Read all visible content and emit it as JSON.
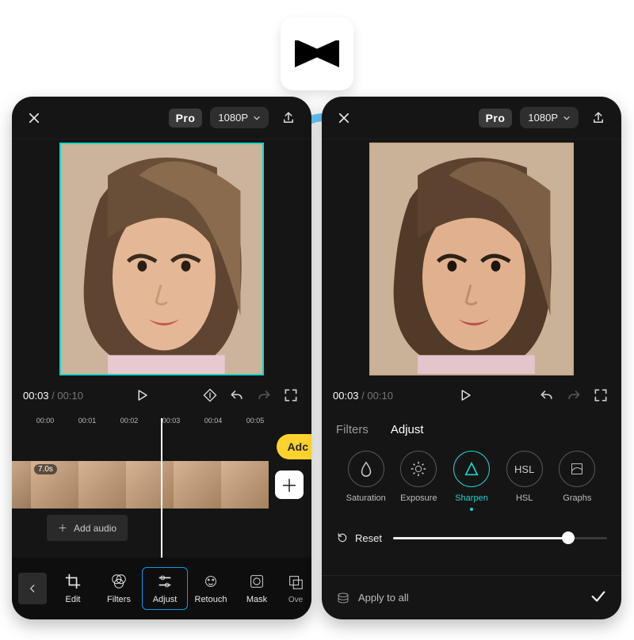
{
  "app_icon_name": "capcut-logo",
  "topbar": {
    "pro_label": "Pro",
    "resolution_label": "1080P"
  },
  "playback": {
    "current_time": "00:03",
    "total_time": "00:10"
  },
  "ruler_marks": [
    "00:00",
    "00:01",
    "00:02",
    "00:03",
    "00:04",
    "00:05"
  ],
  "add_button_visible_text": "Adc",
  "clip_duration_badge": "7.0s",
  "add_audio_label": "Add audio",
  "tools": [
    {
      "id": "edit",
      "label": "Edit"
    },
    {
      "id": "filters",
      "label": "Filters"
    },
    {
      "id": "adjust",
      "label": "Adjust"
    },
    {
      "id": "retouch",
      "label": "Retouch"
    },
    {
      "id": "mask",
      "label": "Mask"
    },
    {
      "id": "overlay_cut",
      "label": "Ove"
    }
  ],
  "tabs": {
    "filters": "Filters",
    "adjust": "Adjust"
  },
  "adjust_options": [
    {
      "id": "saturation",
      "label": "Saturation"
    },
    {
      "id": "exposure",
      "label": "Exposure"
    },
    {
      "id": "sharpen",
      "label": "Sharpen"
    },
    {
      "id": "hsl",
      "label": "HSL",
      "icon_text": "HSL"
    },
    {
      "id": "graphs",
      "label": "Graphs"
    }
  ],
  "reset_label": "Reset",
  "slider": {
    "value_pct": 82
  },
  "apply_all_label": "Apply to all",
  "colors": {
    "accent_teal": "#1ed3c9",
    "accent_blue": "#1596f0",
    "accent_yellow": "#ffd22e"
  }
}
